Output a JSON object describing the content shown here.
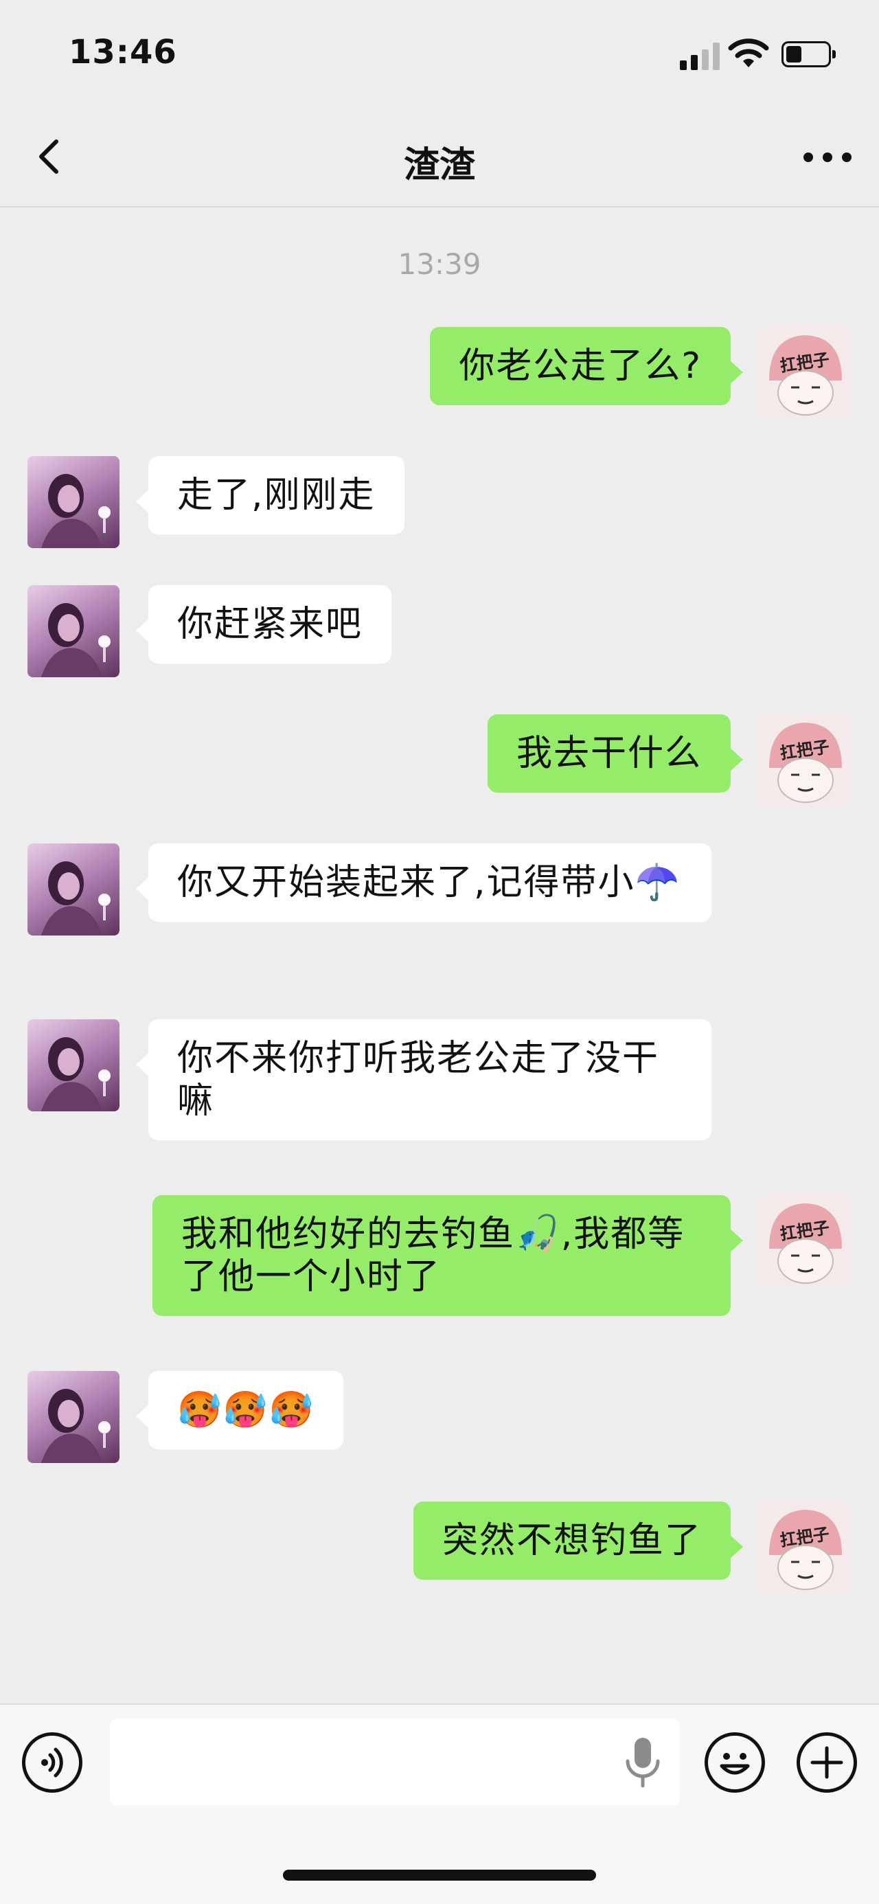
{
  "status_bar": {
    "time": "13:46"
  },
  "header": {
    "title": "渣渣"
  },
  "chat": {
    "timestamp": "13:39",
    "messages": [
      {
        "from": "me",
        "text": "你老公走了么?"
      },
      {
        "from": "her",
        "text": "走了,刚刚走"
      },
      {
        "from": "her",
        "text": "你赶紧来吧"
      },
      {
        "from": "me",
        "text": "我去干什么"
      },
      {
        "from": "her",
        "text": "你又开始装起来了,记得带小☂️"
      },
      {
        "from": "her",
        "text": "你不来你打听我老公走了没干嘛"
      },
      {
        "from": "me",
        "text": "我和他约好的去钓鱼🎣,我都等了他一个小时了"
      },
      {
        "from": "her",
        "text": "🥵🥵🥵"
      },
      {
        "from": "me",
        "text": "突然不想钓鱼了"
      }
    ]
  },
  "my_avatar": {
    "hat_text": "扛把子"
  },
  "input_bar": {
    "value": "",
    "placeholder": ""
  },
  "colors": {
    "background": "#ededed",
    "outgoing_bubble": "#95ec69",
    "incoming_bubble": "#ffffff",
    "timestamp": "#a8a8a8"
  }
}
